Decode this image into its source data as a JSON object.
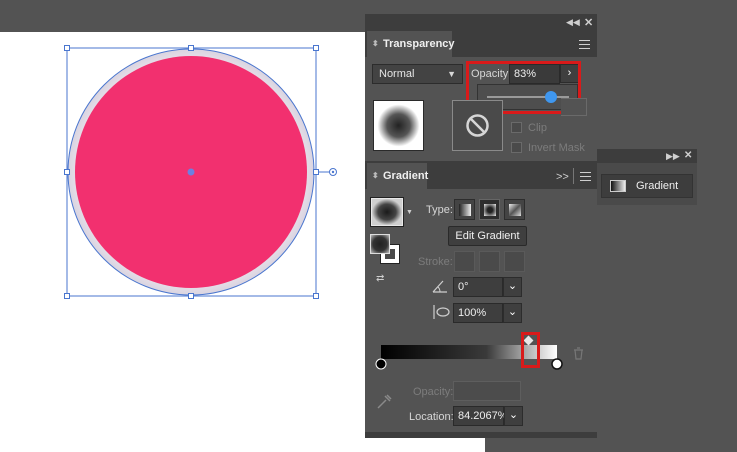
{
  "transparency_panel": {
    "title": "Transparency",
    "blend_mode": "Normal",
    "opacity_label": "Opacity:",
    "opacity_value": "83%",
    "opacity_slider_fraction": 0.83,
    "clip_label": "Clip",
    "invert_mask_label": "Invert Mask"
  },
  "gradient_panel": {
    "title": "Gradient",
    "expand_label": ">>",
    "type_label": "Type:",
    "edit_gradient_label": "Edit Gradient",
    "stroke_label": "Stroke:",
    "angle_value": "0°",
    "aspect_value": "100%",
    "opacity_label": "Opacity:",
    "location_label": "Location:",
    "location_value": "84.2067%",
    "selected_stop_fraction": 0.842
  },
  "collapsed_panel": {
    "label": "Gradient"
  },
  "colors": {
    "artwork_fill": "#f2306f",
    "artwork_halo": "#e9e2ea",
    "selection": "#4a76cf",
    "highlight": "#d91a1a",
    "slider_handle": "#3f97ef"
  },
  "icons": [
    "expand-arrows-icon",
    "close-icon",
    "menu-icon",
    "no-mask-icon",
    "trash-icon",
    "eyedropper-icon",
    "angle-icon",
    "aspect-ratio-icon",
    "gradient-swatch-icon",
    "swap-icon"
  ]
}
